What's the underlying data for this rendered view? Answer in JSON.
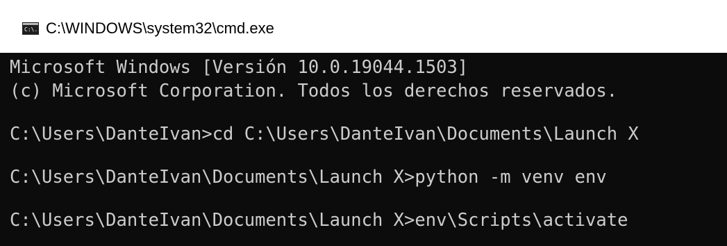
{
  "window": {
    "title": "C:\\WINDOWS\\system32\\cmd.exe",
    "icon": "cmd-icon",
    "icon_text": "C:\\."
  },
  "console": {
    "lines": [
      "Microsoft Windows [Versión 10.0.19044.1503]",
      "(c) Microsoft Corporation. Todos los derechos reservados.",
      "",
      "C:\\Users\\DanteIvan>cd C:\\Users\\DanteIvan\\Documents\\Launch X",
      "",
      "C:\\Users\\DanteIvan\\Documents\\Launch X>python -m venv env",
      "",
      "C:\\Users\\DanteIvan\\Documents\\Launch X>env\\Scripts\\activate"
    ],
    "background": "#0c0c0c",
    "foreground": "#cccccc"
  }
}
